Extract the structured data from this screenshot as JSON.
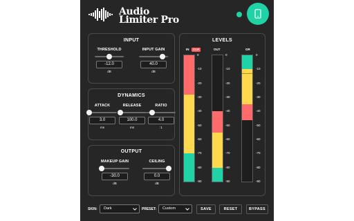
{
  "app": {
    "title_line1": "Audio",
    "title_line2": "Limiter Pro",
    "status_color": "#1fd3a6",
    "mobile_icon": "mobile-phone-icon"
  },
  "input": {
    "title": "INPUT",
    "threshold": {
      "label": "THRESHOLD",
      "value": "-12.0",
      "unit": "dB",
      "level": 0.5
    },
    "gain": {
      "label": "INPUT GAIN",
      "value": "40.0",
      "unit": "dB",
      "level": 0.82
    }
  },
  "dynamics": {
    "title": "DYNAMICS",
    "attack": {
      "label": "ATTACK",
      "value": "3.0",
      "unit": "ms",
      "level": 0.05
    },
    "release": {
      "label": "RELEASE",
      "value": "100.0",
      "unit": "ms",
      "level": 0.1
    },
    "ratio": {
      "label": "RATIO",
      "value": "4.0",
      "unit": ":1",
      "level": 0.2
    }
  },
  "output": {
    "title": "OUTPUT",
    "makeup": {
      "label": "MAKEUP GAIN",
      "value": "-30.0",
      "unit": "dB",
      "level": 0.05
    },
    "ceiling": {
      "label": "CEILING",
      "value": "0.0",
      "unit": "dB",
      "level": 0.9
    }
  },
  "levels": {
    "title": "LEVELS",
    "in_label": "IN",
    "clip_label": "CLIP",
    "out_label": "OUT",
    "gr_label": "GR",
    "scale_range_db": [
      0,
      -90
    ],
    "scale_left": [
      "0",
      "-10",
      "-20",
      "-30",
      "-40",
      "-50",
      "-60",
      "-70",
      "-80",
      "-90"
    ],
    "scale_right": [
      "0",
      "-10",
      "-20",
      "-30",
      "-40",
      "-50",
      "-60",
      "-70",
      "-80",
      "-90"
    ],
    "gr_scale": [
      "0",
      "-10",
      "-20",
      "-30",
      "-40",
      "-50",
      "-60",
      "-70",
      "-80",
      "-90"
    ],
    "in_segments": [
      {
        "from": 0,
        "to": -28,
        "color": "#ff6b6b"
      },
      {
        "from": -28,
        "to": -70,
        "color": "#ffd84d"
      },
      {
        "from": -70,
        "to": -90,
        "color": "#1fd3a6"
      }
    ],
    "out_segments": [
      {
        "from": -40,
        "to": -55,
        "color": "#ff6b6b"
      },
      {
        "from": -55,
        "to": -80,
        "color": "#ffd84d"
      },
      {
        "from": -80,
        "to": -90,
        "color": "#1fd3a6"
      }
    ],
    "gr_segments": [
      {
        "from": 0,
        "to": -10,
        "color": "#1fd3a6"
      },
      {
        "from": -10,
        "to": -35,
        "color": "#ffd84d"
      },
      {
        "from": -35,
        "to": -46,
        "color": "#ff6b6b"
      }
    ],
    "gr_marker_db": -13
  },
  "footer": {
    "skin_label": "SKIN:",
    "skin_value": "Dark",
    "preset_label": "PRESET:",
    "preset_value": "Custom",
    "save_label": "SAVE",
    "reset_label": "RESET",
    "bypass_label": "BYPASS"
  }
}
